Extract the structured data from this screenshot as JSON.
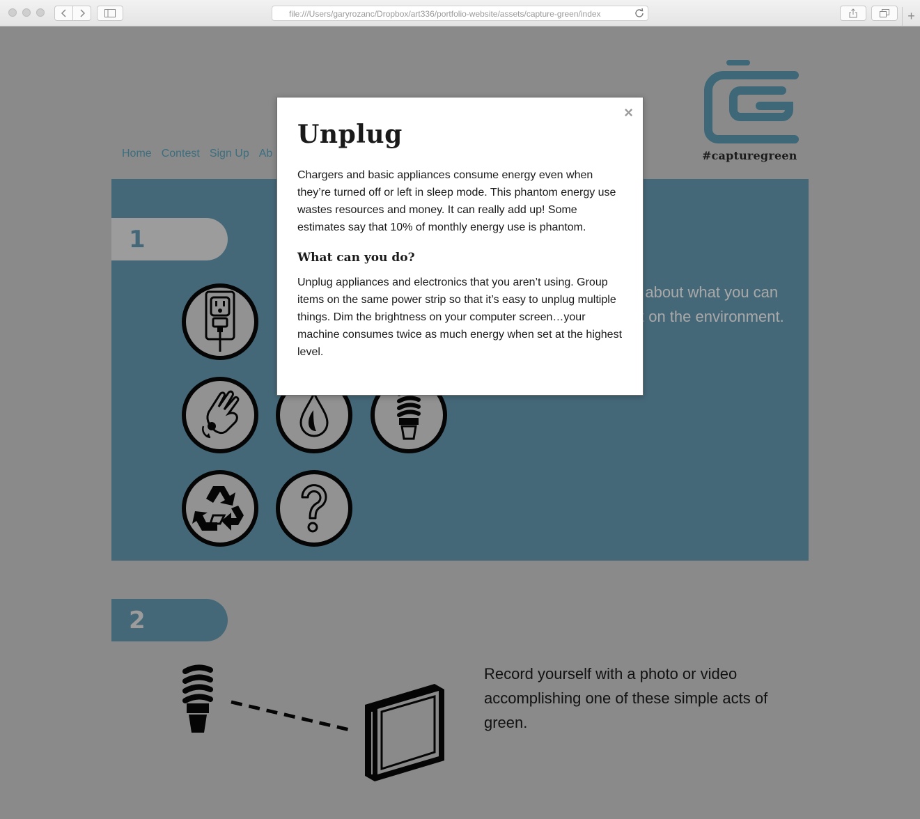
{
  "browser": {
    "url": "file:///Users/garyrozanc/Dropbox/art336/portfolio-website/assets/capture-green/index",
    "new_tab_label": "+"
  },
  "site": {
    "hashtag": "#capturegreen",
    "nav": [
      "Home",
      "Contest",
      "Sign Up",
      "Ab"
    ]
  },
  "step1": {
    "number": "1",
    "text_lines": [
      "n about what you can",
      "ct on the environment."
    ],
    "icons": [
      "outlet-plug-icon",
      "hands-icon",
      "water-drop-icon",
      "cfl-bulb-icon",
      "recycle-icon",
      "question-icon"
    ]
  },
  "step2": {
    "number": "2",
    "text": "Record yourself with a photo or video accomplishing one of these simple acts of green."
  },
  "modal": {
    "close_label": "×",
    "title": "Unplug",
    "paragraph1": "Chargers and basic appliances consume energy even when they’re turned off or left in sleep mode. This phantom energy use wastes resources and money. It can really add up! Some estimates say that 10% of monthly energy use is phantom.",
    "subtitle": "What can you do?",
    "paragraph2": "Unplug appliances and electronics that you aren’t using. Group items on the same power strip so that it’s easy to unplug multiple things. Dim the brightness on your computer screen…your machine consumes twice as much energy when set at the highest level."
  },
  "colors": {
    "overlay_bg": "#8a8a8a",
    "panel_blue": "#456878",
    "nav_link": "#3b6f80",
    "logo_blue": "#3e6878"
  }
}
